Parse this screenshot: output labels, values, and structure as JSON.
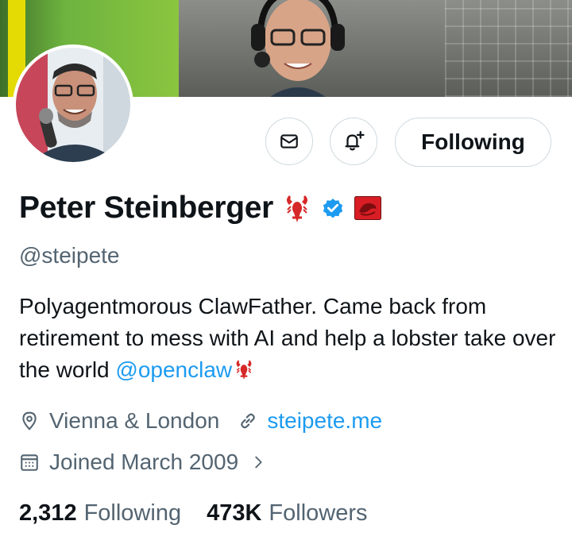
{
  "profile": {
    "name": "Peter Steinberger",
    "handle": "@steipete",
    "bio_text": "Polyagentmorous ClawFather. Came back from retirement to mess with AI and help a lobster take over the world ",
    "bio_mention": "@openclaw",
    "location": "Vienna & London",
    "website": "steipete.me",
    "joined": "Joined March 2009",
    "following_count": "2,312",
    "following_label": "Following",
    "followers_count": "473K",
    "followers_label": "Followers"
  },
  "actions": {
    "follow_button_label": "Following"
  },
  "icons": {
    "message": "envelope-icon",
    "notifications": "bell-plus-icon",
    "location": "map-pin-icon",
    "website": "link-icon",
    "joined": "calendar-icon",
    "verified": "verified-badge-icon",
    "emoji": "lobster-emoji",
    "affiliate": "affiliate-badge"
  },
  "colors": {
    "accent": "#1d9bf0",
    "secondary_text": "#536471",
    "primary_text": "#0f1419",
    "border": "#cfd9de",
    "lobster": "#d62828"
  }
}
